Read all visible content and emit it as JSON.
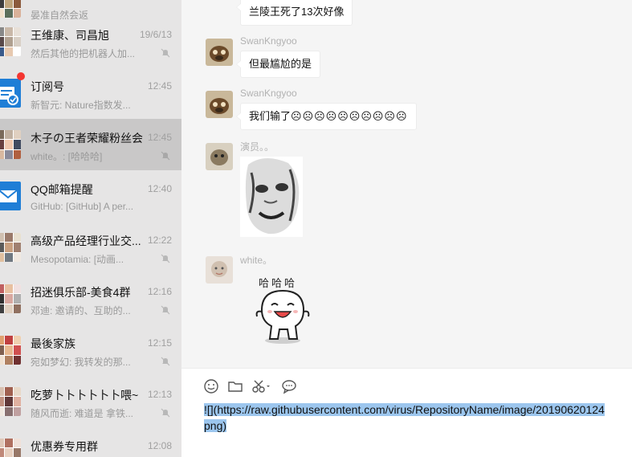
{
  "chat_list": [
    {
      "name": "",
      "time": "",
      "preview": "晏准自然会返",
      "muted": false
    },
    {
      "name": "王维康、司昌旭",
      "time": "19/6/13",
      "preview": "然后其他的把机器人加...",
      "muted": true
    },
    {
      "name": "订阅号",
      "time": "12:45",
      "preview": "新智元: Nature指数发...",
      "muted": false,
      "unread": true
    },
    {
      "name": "木子の王者荣耀粉丝会",
      "time": "12:45",
      "preview": "white。: [哈哈哈]",
      "muted": true,
      "selected": true
    },
    {
      "name": "QQ邮箱提醒",
      "time": "12:40",
      "preview": "GitHub: [GitHub] A per...",
      "muted": false
    },
    {
      "name": "高级产品经理行业交...",
      "time": "12:22",
      "preview": "Mesopotamia: [动画...",
      "muted": true
    },
    {
      "name": "招迷俱乐部-美食4群",
      "time": "12:16",
      "preview": "邓迪: 邀请的、互助的...",
      "muted": true
    },
    {
      "name": "最後家族",
      "time": "12:15",
      "preview": "宛如梦幻: 我转发的那...",
      "muted": true
    },
    {
      "name": "吃萝卜卜卜卜卜卜喂~",
      "time": "12:13",
      "preview": "随风而逝: 难道是  拿铁...",
      "muted": true
    },
    {
      "name": "优惠券专用群",
      "time": "12:08",
      "preview": "",
      "muted": false
    }
  ],
  "messages": {
    "top_bubble_text": "兰陵王死了13次好像",
    "m1": {
      "sender": "SwanKngyoo",
      "text": "但最尴尬的是"
    },
    "m2": {
      "sender": "SwanKngyoo",
      "text": "我们输了",
      "emoji": "☹☹☹☹☹☹☹☹☹☹"
    },
    "m3": {
      "sender": "演员。。",
      "sticker": "face-sticker"
    },
    "m4": {
      "sender": "white。",
      "sticker_text": "哈哈哈"
    }
  },
  "composer": {
    "text": "![](https://raw.githubusercontent.com/virus/RepositoryName/image/20190620124",
    "text_line2": "png)",
    "tools": [
      "smile-icon",
      "folder-icon",
      "scissors-icon",
      "chat-bubble-icon"
    ]
  }
}
